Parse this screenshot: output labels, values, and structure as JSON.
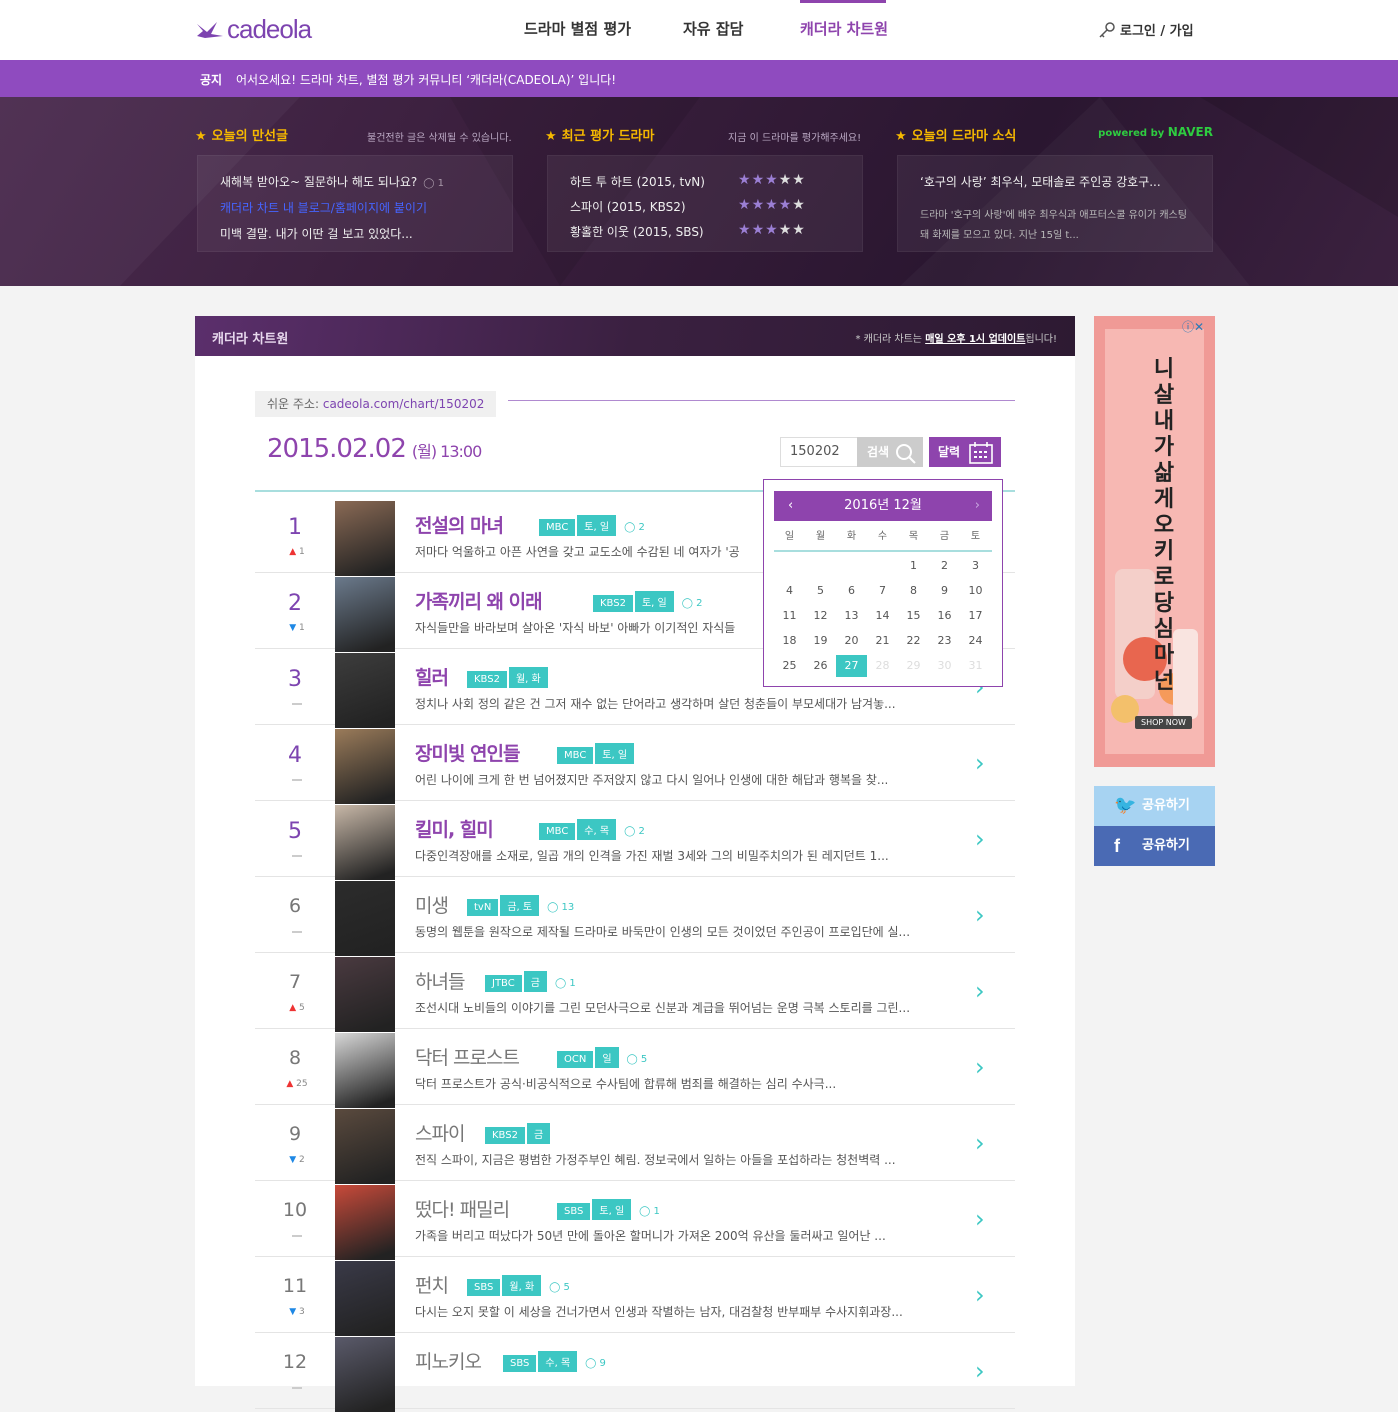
{
  "header": {
    "logo": "cadeola",
    "nav": [
      "드라마 별점 평가",
      "자유 잡담",
      "캐더라 차트원"
    ],
    "active_index": 2,
    "login": "로그인 / 가입"
  },
  "notice": {
    "label": "공지",
    "text": "어서오세요! 드라마 차트, 별점 평가 커뮤니티 ‘캐더라(CADEOLA)’ 입니다!"
  },
  "hero": {
    "best_posts": {
      "title": "오늘의 만선글",
      "subtitle": "불건전한 글은 삭제될 수 있습니다.",
      "items": [
        {
          "text": "새해복 받아오~ 질문하나 해도 되나요?",
          "comments": "1"
        },
        {
          "text": "캐더라 차트 내 블로그/홈페이지에 붙이기",
          "comments": ""
        },
        {
          "text": "미백 결말. 내가 이딴 걸 보고 있었다...",
          "comments": ""
        }
      ]
    },
    "recent_ratings": {
      "title": "최근 평가 드라마",
      "subtitle": "지금 이 드라마를 평가해주세요!",
      "items": [
        {
          "text": "하트 투 하트 (2015, tvN)",
          "stars": 3
        },
        {
          "text": "스파이 (2015, KBS2)",
          "stars": 4
        },
        {
          "text": "황홀한 이웃 (2015, SBS)",
          "stars": 3
        }
      ]
    },
    "news": {
      "title": "오늘의 드라마 소식",
      "powered_prefix": "powered by",
      "powered_brand": "NAVER",
      "headline": "‘호구의 사랑’ 최우식, 모태솔로 주인공 강호구...",
      "summary": "드라마 '호구의 사랑'에 배우 최우식과 애프터스쿨 유이가 캐스팅돼 화제를 모으고 있다. 지난 15일 t..."
    }
  },
  "chart": {
    "header_title": "캐더라 차트원",
    "header_note_prefix": "* 캐더라 차트는 ",
    "header_note_strong": "매일 오후 1시 업데이트",
    "header_note_suffix": "됩니다!",
    "short_url_label": "쉬운 주소: ",
    "short_url": "cadeola.com/chart/150202",
    "date": "2015.02.02",
    "time": "(월) 13:00",
    "search_value": "150202",
    "search_btn": "검색",
    "calendar_btn": "달력",
    "calendar": {
      "title": "2016년 12월",
      "prev": "‹",
      "next": "›",
      "weekdays": [
        "일",
        "월",
        "화",
        "수",
        "목",
        "금",
        "토"
      ],
      "today": "27"
    },
    "rows": [
      {
        "rank": "1",
        "dir": "up",
        "change": "1",
        "title": "전설의 마녀",
        "tags": [
          "MBC",
          "토, 일"
        ],
        "comments": "2",
        "desc": "저마다 억울하고 아픈 사연을 갖고 교도소에 수감된 네 여자가 '공",
        "color": "#8a6a55"
      },
      {
        "rank": "2",
        "dir": "down",
        "change": "1",
        "title": "가족끼리 왜 이래",
        "tags": [
          "KBS2",
          "토, 일"
        ],
        "comments": "2",
        "desc": "자식들만을 바라보며 살아온 '자식 바보' 아빠가 이기적인 자식들",
        "color": "#6b7a8c"
      },
      {
        "rank": "3",
        "dir": "same",
        "change": "",
        "title": "힐러",
        "tags": [
          "KBS2",
          "월, 화"
        ],
        "comments": "",
        "desc": "정치나 사회 정의 같은 건 그저 재수 없는 단어라고 생각하며 살던 청춘들이 부모세대가 남겨놓...",
        "color": "#3d3d3d"
      },
      {
        "rank": "4",
        "dir": "same",
        "change": "",
        "title": "장미빛 연인들",
        "tags": [
          "MBC",
          "토, 일"
        ],
        "comments": "",
        "desc": "어린 나이에 크게 한 번 넘어졌지만 주저앉지 않고 다시 일어나 인생에 대한 해답과 행복을 찾...",
        "color": "#9a7b5a"
      },
      {
        "rank": "5",
        "dir": "same",
        "change": "",
        "title": "킬미, 힐미",
        "tags": [
          "MBC",
          "수, 목"
        ],
        "comments": "2",
        "desc": "다중인격장애를 소재로, 일곱 개의 인격을 가진 재벌 3세와 그의 비밀주치의가 된 레지던트 1...",
        "color": "#c8b8a8"
      },
      {
        "rank": "6",
        "dir": "same",
        "change": "",
        "title": "미생",
        "tags": [
          "tvN",
          "금, 토"
        ],
        "comments": "13",
        "desc": "동명의 웹툰을 원작으로 제작될 드라마로 바둑만이 인생의 모든 것이었던 주인공이 프로입단에 실...",
        "color": "#2c2c2c"
      },
      {
        "rank": "7",
        "dir": "up",
        "change": "5",
        "title": "하녀들",
        "tags": [
          "JTBC",
          "금"
        ],
        "comments": "1",
        "desc": "조선시대 노비들의 이야기를 그린 모던사극으로 신분과 계급을 뛰어넘는 운명 극복 스토리를 그린...",
        "color": "#4a3a40"
      },
      {
        "rank": "8",
        "dir": "up",
        "change": "25",
        "title": "닥터 프로스트",
        "tags": [
          "OCN",
          "일"
        ],
        "comments": "5",
        "desc": "닥터 프로스트가 공식·비공식적으로 수사팀에 합류해 범죄를 해결하는 심리 수사극...",
        "color": "#d8d8d8"
      },
      {
        "rank": "9",
        "dir": "down",
        "change": "2",
        "title": "스파이",
        "tags": [
          "KBS2",
          "금"
        ],
        "comments": "",
        "desc": "전직 스파이, 지금은 평범한 가정주부인 혜림. 정보국에서 일하는 아들을 포섭하라는 청천벽력 ...",
        "color": "#5a4a3e"
      },
      {
        "rank": "10",
        "dir": "same",
        "change": "",
        "title": "떴다! 패밀리",
        "tags": [
          "SBS",
          "토, 일"
        ],
        "comments": "1",
        "desc": "가족을 버리고 떠났다가 50년 만에 돌아온 할머니가 가져온 200억 유산을 둘러싸고 일어난 ...",
        "color": "#c84a3a"
      },
      {
        "rank": "11",
        "dir": "down",
        "change": "3",
        "title": "펀치",
        "tags": [
          "SBS",
          "월, 화"
        ],
        "comments": "5",
        "desc": "다시는 오지 못할 이 세상을 건너가면서 인생과 작별하는 남자, 대검찰청 반부패부 수사지휘과장...",
        "color": "#3a3a48"
      },
      {
        "rank": "12",
        "dir": "same",
        "change": "",
        "title": "피노키오",
        "tags": [
          "SBS",
          "수, 목"
        ],
        "comments": "9",
        "desc": "",
        "color": "#5a5a6a"
      }
    ]
  },
  "ad": {
    "text": "니 살 내가 삶게 오키로당 심마넌",
    "shop": "SHOP NOW"
  },
  "share": {
    "twitter": "공유하기",
    "facebook": "공유하기"
  }
}
